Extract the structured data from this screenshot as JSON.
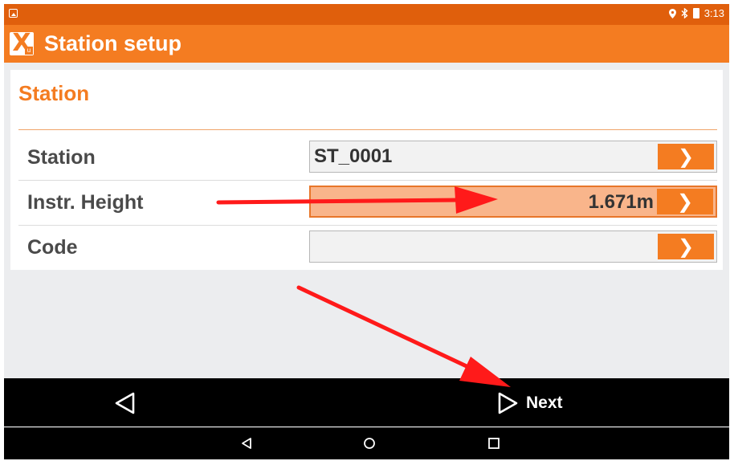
{
  "status_bar": {
    "time": "3:13",
    "icons": [
      "gallery-icon",
      "location-icon",
      "bluetooth-icon",
      "battery-icon"
    ]
  },
  "app_bar": {
    "title": "Station setup",
    "logo_icon": "x-logo-icon"
  },
  "section": {
    "title": "Station"
  },
  "rows": [
    {
      "label": "Station",
      "value": "ST_0001",
      "button_icon": "chevron-right-icon"
    },
    {
      "label": "Instr. Height",
      "value": "1.671m",
      "button_icon": "chevron-right-icon"
    },
    {
      "label": "Code",
      "value": "",
      "button_icon": "chevron-right-icon"
    }
  ],
  "bottom_bar": {
    "back_icon": "triangle-left-icon",
    "next_label": "Next"
  },
  "system_nav": {
    "icons": [
      "back-icon",
      "home-icon",
      "recents-icon"
    ]
  },
  "annotations": [
    "red-arrow-to-instr-height",
    "red-arrow-to-next"
  ],
  "colors": {
    "accent": "#f47c21",
    "status_bar": "#e05f0c",
    "active_field": "#f9b58b",
    "arrow": "#ff1a1a"
  },
  "chev_glyph": "❯"
}
